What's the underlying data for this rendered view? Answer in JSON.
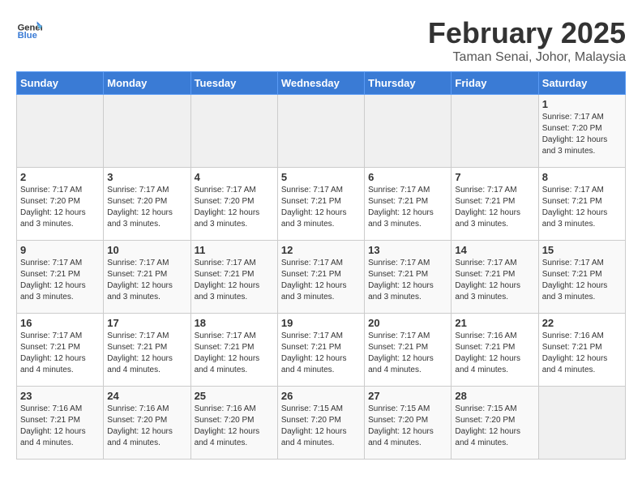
{
  "header": {
    "logo_general": "General",
    "logo_blue": "Blue",
    "title": "February 2025",
    "subtitle": "Taman Senai, Johor, Malaysia"
  },
  "weekdays": [
    "Sunday",
    "Monday",
    "Tuesday",
    "Wednesday",
    "Thursday",
    "Friday",
    "Saturday"
  ],
  "weeks": [
    [
      {
        "day": "",
        "empty": true
      },
      {
        "day": "",
        "empty": true
      },
      {
        "day": "",
        "empty": true
      },
      {
        "day": "",
        "empty": true
      },
      {
        "day": "",
        "empty": true
      },
      {
        "day": "",
        "empty": true
      },
      {
        "day": "1",
        "sunrise": "7:17 AM",
        "sunset": "7:20 PM",
        "daylight": "12 hours and 3 minutes."
      }
    ],
    [
      {
        "day": "2",
        "sunrise": "7:17 AM",
        "sunset": "7:20 PM",
        "daylight": "12 hours and 3 minutes."
      },
      {
        "day": "3",
        "sunrise": "7:17 AM",
        "sunset": "7:20 PM",
        "daylight": "12 hours and 3 minutes."
      },
      {
        "day": "4",
        "sunrise": "7:17 AM",
        "sunset": "7:20 PM",
        "daylight": "12 hours and 3 minutes."
      },
      {
        "day": "5",
        "sunrise": "7:17 AM",
        "sunset": "7:21 PM",
        "daylight": "12 hours and 3 minutes."
      },
      {
        "day": "6",
        "sunrise": "7:17 AM",
        "sunset": "7:21 PM",
        "daylight": "12 hours and 3 minutes."
      },
      {
        "day": "7",
        "sunrise": "7:17 AM",
        "sunset": "7:21 PM",
        "daylight": "12 hours and 3 minutes."
      },
      {
        "day": "8",
        "sunrise": "7:17 AM",
        "sunset": "7:21 PM",
        "daylight": "12 hours and 3 minutes."
      }
    ],
    [
      {
        "day": "9",
        "sunrise": "7:17 AM",
        "sunset": "7:21 PM",
        "daylight": "12 hours and 3 minutes."
      },
      {
        "day": "10",
        "sunrise": "7:17 AM",
        "sunset": "7:21 PM",
        "daylight": "12 hours and 3 minutes."
      },
      {
        "day": "11",
        "sunrise": "7:17 AM",
        "sunset": "7:21 PM",
        "daylight": "12 hours and 3 minutes."
      },
      {
        "day": "12",
        "sunrise": "7:17 AM",
        "sunset": "7:21 PM",
        "daylight": "12 hours and 3 minutes."
      },
      {
        "day": "13",
        "sunrise": "7:17 AM",
        "sunset": "7:21 PM",
        "daylight": "12 hours and 3 minutes."
      },
      {
        "day": "14",
        "sunrise": "7:17 AM",
        "sunset": "7:21 PM",
        "daylight": "12 hours and 3 minutes."
      },
      {
        "day": "15",
        "sunrise": "7:17 AM",
        "sunset": "7:21 PM",
        "daylight": "12 hours and 3 minutes."
      }
    ],
    [
      {
        "day": "16",
        "sunrise": "7:17 AM",
        "sunset": "7:21 PM",
        "daylight": "12 hours and 4 minutes."
      },
      {
        "day": "17",
        "sunrise": "7:17 AM",
        "sunset": "7:21 PM",
        "daylight": "12 hours and 4 minutes."
      },
      {
        "day": "18",
        "sunrise": "7:17 AM",
        "sunset": "7:21 PM",
        "daylight": "12 hours and 4 minutes."
      },
      {
        "day": "19",
        "sunrise": "7:17 AM",
        "sunset": "7:21 PM",
        "daylight": "12 hours and 4 minutes."
      },
      {
        "day": "20",
        "sunrise": "7:17 AM",
        "sunset": "7:21 PM",
        "daylight": "12 hours and 4 minutes."
      },
      {
        "day": "21",
        "sunrise": "7:16 AM",
        "sunset": "7:21 PM",
        "daylight": "12 hours and 4 minutes."
      },
      {
        "day": "22",
        "sunrise": "7:16 AM",
        "sunset": "7:21 PM",
        "daylight": "12 hours and 4 minutes."
      }
    ],
    [
      {
        "day": "23",
        "sunrise": "7:16 AM",
        "sunset": "7:21 PM",
        "daylight": "12 hours and 4 minutes."
      },
      {
        "day": "24",
        "sunrise": "7:16 AM",
        "sunset": "7:20 PM",
        "daylight": "12 hours and 4 minutes."
      },
      {
        "day": "25",
        "sunrise": "7:16 AM",
        "sunset": "7:20 PM",
        "daylight": "12 hours and 4 minutes."
      },
      {
        "day": "26",
        "sunrise": "7:15 AM",
        "sunset": "7:20 PM",
        "daylight": "12 hours and 4 minutes."
      },
      {
        "day": "27",
        "sunrise": "7:15 AM",
        "sunset": "7:20 PM",
        "daylight": "12 hours and 4 minutes."
      },
      {
        "day": "28",
        "sunrise": "7:15 AM",
        "sunset": "7:20 PM",
        "daylight": "12 hours and 4 minutes."
      },
      {
        "day": "",
        "empty": true
      }
    ]
  ]
}
